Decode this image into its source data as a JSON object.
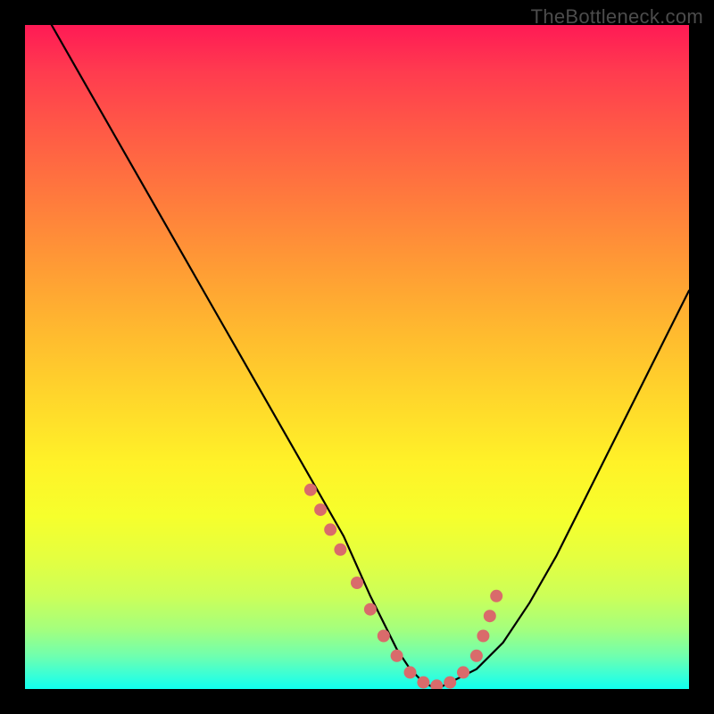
{
  "watermark": {
    "text": "TheBottleneck.com"
  },
  "chart_data": {
    "type": "line",
    "title": "",
    "xlabel": "",
    "ylabel": "",
    "xlim": [
      0,
      100
    ],
    "ylim": [
      0,
      100
    ],
    "series": [
      {
        "name": "bottleneck-curve",
        "x": [
          4,
          8,
          12,
          16,
          20,
          24,
          28,
          32,
          36,
          40,
          44,
          48,
          52,
          54,
          56,
          58,
          60,
          62,
          64,
          68,
          72,
          76,
          80,
          84,
          88,
          92,
          96,
          100
        ],
        "y": [
          100,
          93,
          86,
          79,
          72,
          65,
          58,
          51,
          44,
          37,
          30,
          23,
          14,
          10,
          6,
          3,
          1,
          0,
          1,
          3,
          7,
          13,
          20,
          28,
          36,
          44,
          52,
          60
        ]
      }
    ],
    "markers": {
      "name": "highlight-dots",
      "color": "#d96b6b",
      "x": [
        43,
        44.5,
        46,
        47.5,
        50,
        52,
        54,
        56,
        58,
        60,
        62,
        64,
        66,
        68,
        69,
        70,
        71
      ],
      "y": [
        30,
        27,
        24,
        21,
        16,
        12,
        8,
        5,
        2.5,
        1,
        0.5,
        1,
        2.5,
        5,
        8,
        11,
        14
      ]
    }
  }
}
